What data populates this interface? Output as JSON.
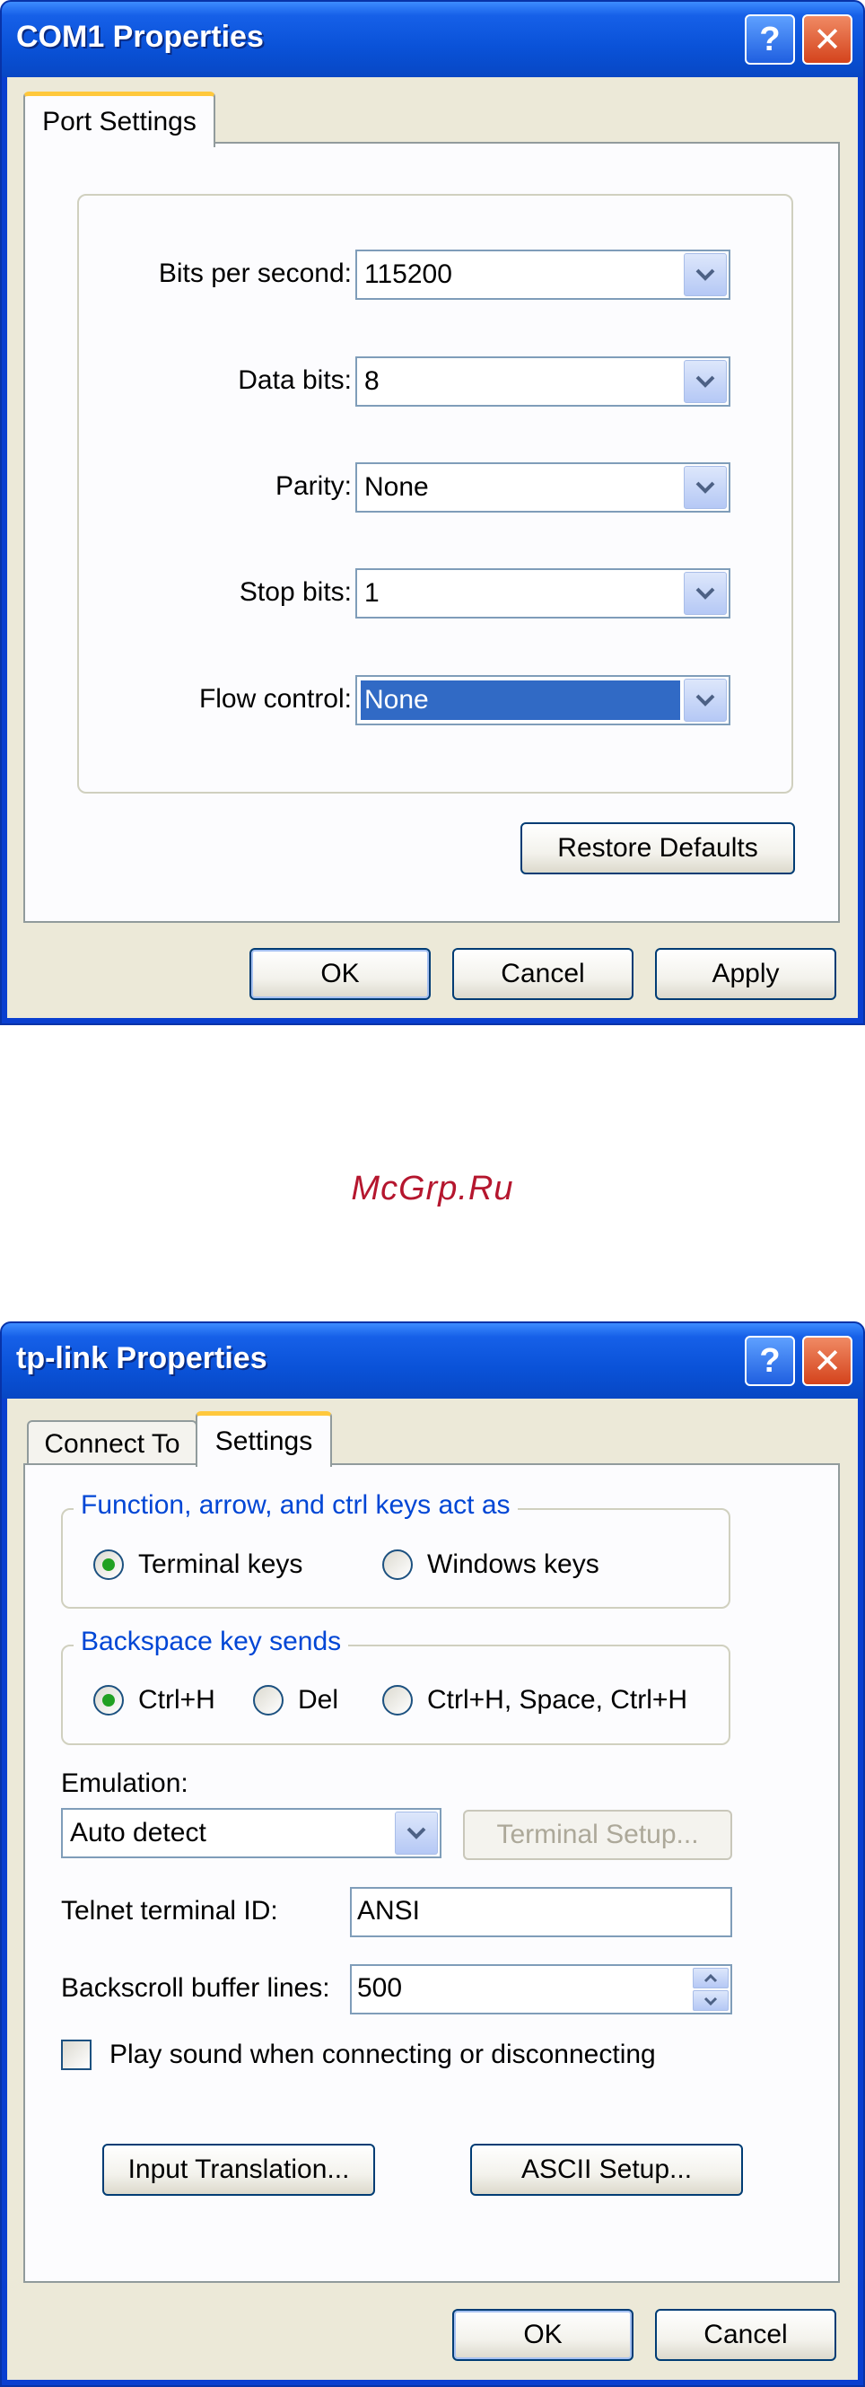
{
  "dialog1": {
    "title": "COM1 Properties",
    "help_glyph": "?",
    "close_glyph": "✕",
    "tabs": [
      {
        "label": "Port Settings",
        "active": true
      }
    ],
    "fields": [
      {
        "label": "Bits per second:",
        "value": "115200"
      },
      {
        "label": "Data bits:",
        "value": "8"
      },
      {
        "label": "Parity:",
        "value": "None"
      },
      {
        "label": "Stop bits:",
        "value": "1"
      },
      {
        "label": "Flow control:",
        "value": "None",
        "selected": true
      }
    ],
    "restore_defaults_label": "Restore Defaults",
    "ok_label": "OK",
    "cancel_label": "Cancel",
    "apply_label": "Apply"
  },
  "watermark": "McGrp.Ru",
  "dialog2": {
    "title": "tp-link Properties",
    "help_glyph": "?",
    "close_glyph": "✕",
    "tabs": [
      {
        "label": "Connect To",
        "active": false
      },
      {
        "label": "Settings",
        "active": true
      }
    ],
    "keys_group": {
      "legend": "Function, arrow, and ctrl keys act as",
      "options": [
        {
          "label": "Terminal keys",
          "checked": true
        },
        {
          "label": "Windows keys",
          "checked": false
        }
      ]
    },
    "backspace_group": {
      "legend": "Backspace key sends",
      "options": [
        {
          "label": "Ctrl+H",
          "checked": true
        },
        {
          "label": "Del",
          "checked": false
        },
        {
          "label": "Ctrl+H, Space, Ctrl+H",
          "checked": false
        }
      ]
    },
    "emulation_label": "Emulation:",
    "emulation_value": "Auto detect",
    "terminal_setup_label": "Terminal Setup...",
    "telnet_id_label": "Telnet terminal ID:",
    "telnet_id_value": "ANSI",
    "backscroll_label": "Backscroll buffer lines:",
    "backscroll_value": "500",
    "play_sound_label": "Play sound when connecting or disconnecting",
    "play_sound_checked": false,
    "input_translation_label": "Input Translation...",
    "ascii_setup_label": "ASCII Setup...",
    "ok_label": "OK",
    "cancel_label": "Cancel"
  },
  "colors": {
    "titlebar": "#0a52d8",
    "dialog_bg": "#ece9d8",
    "group_legend": "#0046d5",
    "selection": "#316ac5",
    "radio_dot": "#21a121",
    "watermark": "#b5162e"
  },
  "icons": {
    "dropdown": "chevron-down-icon",
    "spin_up": "chevron-up-icon",
    "spin_down": "chevron-down-icon"
  }
}
